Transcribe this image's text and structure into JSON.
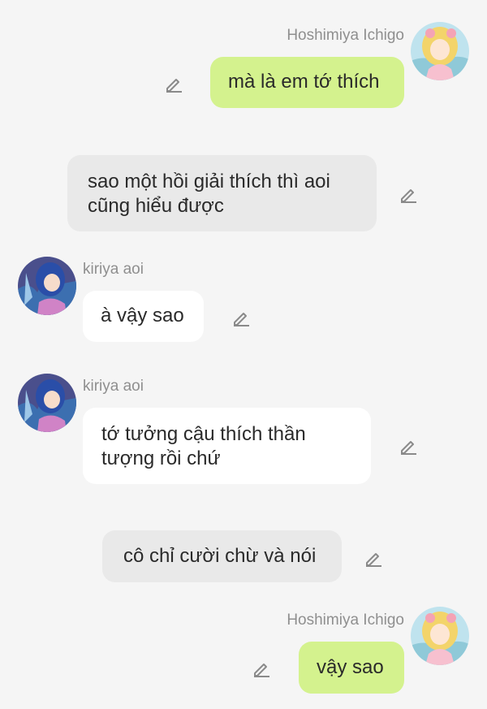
{
  "messages": [
    {
      "kind": "sent",
      "sender": "Hoshimiya Ichigo",
      "avatar_icon": "avatar-hoshimiya-ichigo",
      "text": "mà là em tớ thích"
    },
    {
      "kind": "narration",
      "text": "sao một hồi giải thích thì aoi cũng hiểu được"
    },
    {
      "kind": "received",
      "sender": "kiriya aoi",
      "avatar_icon": "avatar-kiriya-aoi",
      "text": "à vậy sao"
    },
    {
      "kind": "received",
      "sender": "kiriya aoi",
      "avatar_icon": "avatar-kiriya-aoi",
      "text": "tớ tưởng cậu thích thần tượng rồi chứ"
    },
    {
      "kind": "narration",
      "text": "cô chỉ cười chừ và nói"
    },
    {
      "kind": "sent",
      "sender": "Hoshimiya Ichigo",
      "avatar_icon": "avatar-hoshimiya-ichigo",
      "text": "vậy sao"
    }
  ],
  "icons": {
    "edit": "pencil-edit-icon"
  },
  "colors": {
    "background": "#f5f5f5",
    "sent_bubble": "#d4f28e",
    "narration_bubble": "#e9e9e9",
    "received_bubble": "#ffffff",
    "name_text": "#8f8f8f",
    "message_text": "#2a2a2a"
  }
}
